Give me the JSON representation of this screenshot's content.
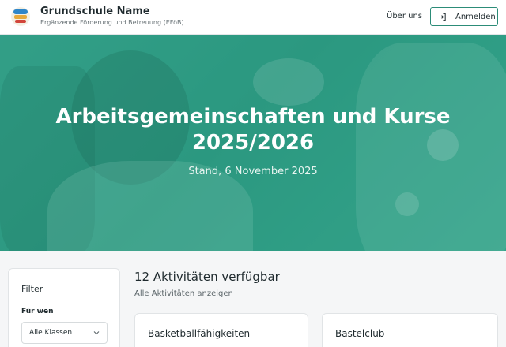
{
  "header": {
    "title": "Grundschule Name",
    "subtitle": "Ergänzende Förderung und Betreuung (EFöB)",
    "nav_about": "Über uns",
    "login_label": "Anmelden",
    "logo_icon": "school-logo",
    "login_icon": "sign-in-icon",
    "accent_color": "#2c8c78"
  },
  "hero": {
    "title_line1": "Arbeitsgemeinschaften und Kurse",
    "title_line2": "2025/2026",
    "subtitle": "Stand, 6 November 2025",
    "overlay_color": "#2f9a83"
  },
  "filter": {
    "title": "Filter",
    "for_whom_label": "Für wen",
    "select_value": "Alle Klassen",
    "select_icon": "chevron-down-icon"
  },
  "main": {
    "count_title": "12 Aktivitäten verfügbar",
    "show_all_link": "Alle Aktivitäten anzeigen",
    "cards": [
      {
        "name": "Basketballfähigkeiten"
      },
      {
        "name": "Bastelclub"
      }
    ]
  }
}
